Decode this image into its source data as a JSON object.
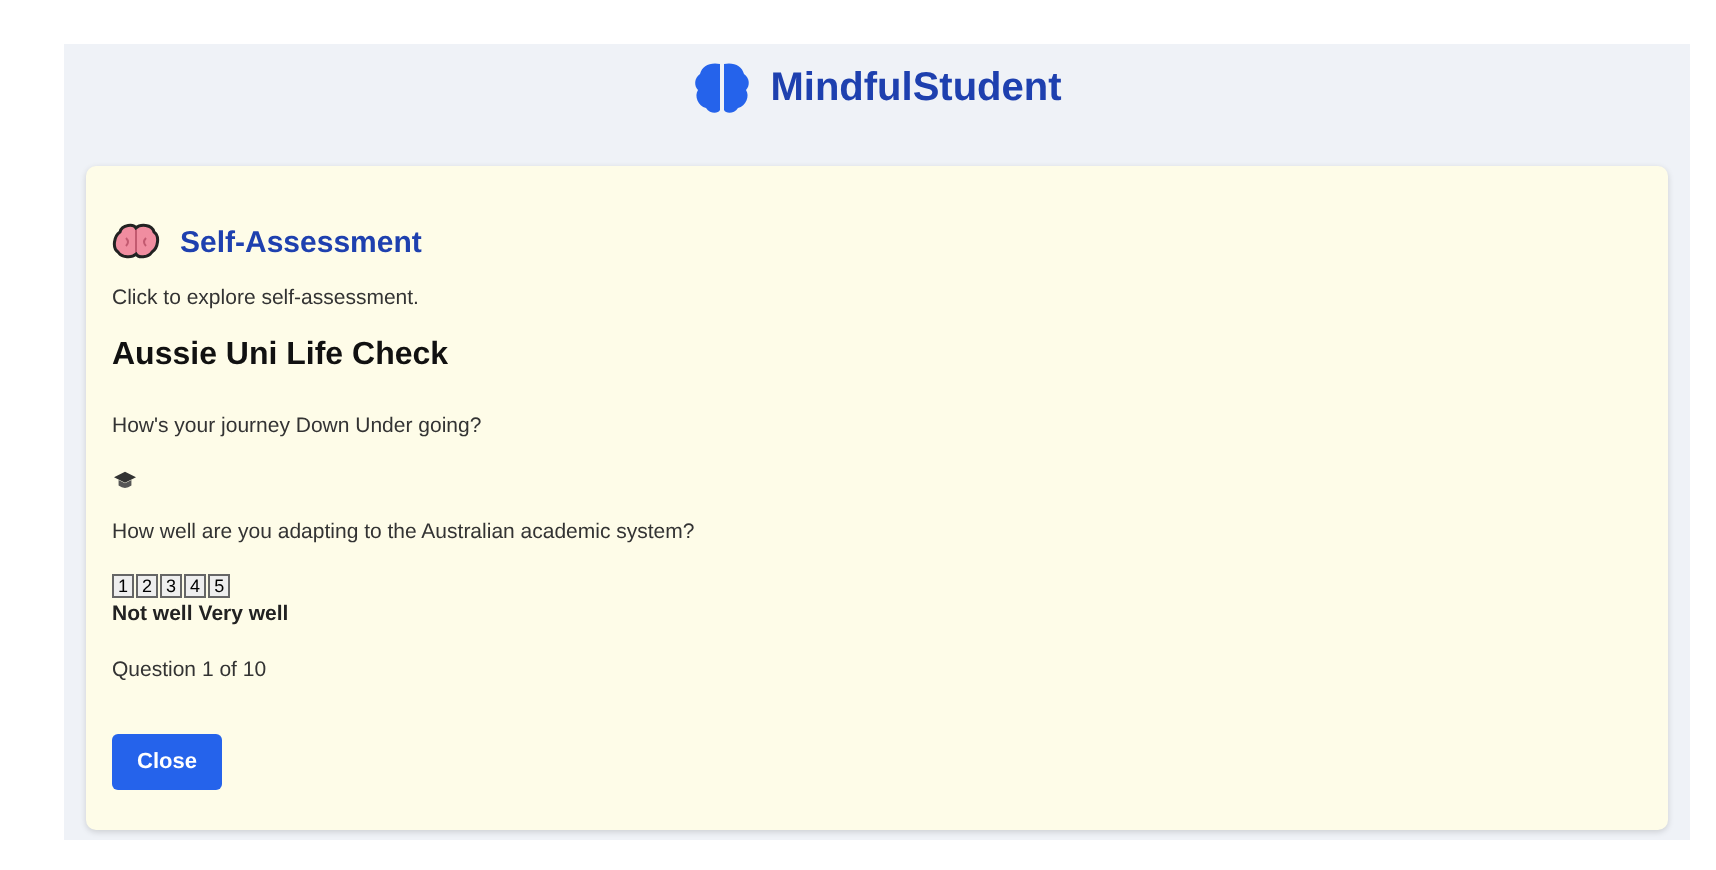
{
  "header": {
    "title": "MindfulStudent"
  },
  "section": {
    "title": "Self-Assessment",
    "hint": "Click to explore self-assessment."
  },
  "quiz": {
    "title": "Aussie Uni Life Check",
    "intro": "How's your journey Down Under going?",
    "question": "How well are you adapting to the Australian academic system?",
    "scale": [
      "1",
      "2",
      "3",
      "4",
      "5"
    ],
    "scale_labels": [
      "Not well",
      "Very well"
    ],
    "progress": "Question 1 of 10"
  },
  "buttons": [
    "Close"
  ]
}
